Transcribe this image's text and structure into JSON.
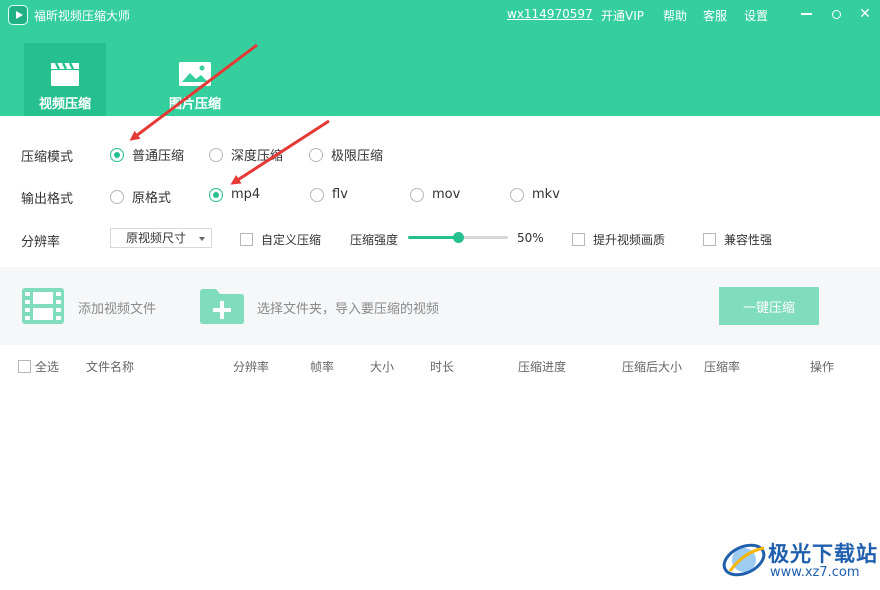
{
  "window": {
    "title": "福昕视频压缩大师",
    "account": "wx114970597",
    "links": {
      "vip": "开通VIP",
      "help": "帮助",
      "service": "客服",
      "settings": "设置"
    }
  },
  "tabs": [
    {
      "label": "视频压缩",
      "active": true,
      "icon": "clapperboard-icon"
    },
    {
      "label": "图片压缩",
      "active": false,
      "icon": "image-icon"
    }
  ],
  "settings": {
    "mode": {
      "label": "压缩模式",
      "options": [
        "普通压缩",
        "深度压缩",
        "极限压缩"
      ],
      "selected": "普通压缩"
    },
    "format": {
      "label": "输出格式",
      "options": [
        "原格式",
        "mp4",
        "flv",
        "mov",
        "mkv"
      ],
      "selected": "mp4"
    },
    "resolution": {
      "label": "分辨率",
      "value": "原视频尺寸",
      "custom_label": "自定义压缩",
      "strength_label": "压缩强度",
      "strength_value": "50%",
      "strength_fraction": 0.5,
      "enhance_label": "提升视频画质",
      "compat_label": "兼容性强"
    }
  },
  "actions": {
    "add_video": "添加视频文件",
    "select_folder": "选择文件夹，导入要压缩的视频",
    "one_key": "一键压缩"
  },
  "table": {
    "select_all": "全选",
    "columns": [
      "文件名称",
      "分辨率",
      "帧率",
      "大小",
      "时长",
      "压缩进度",
      "压缩后大小",
      "压缩率",
      "操作"
    ]
  },
  "watermark": {
    "name": "极光下载站",
    "url": "www.xz7.com"
  },
  "colors": {
    "accent": "#35cf9e",
    "accent_dark": "#26c08f",
    "arrow": "#e53935"
  }
}
